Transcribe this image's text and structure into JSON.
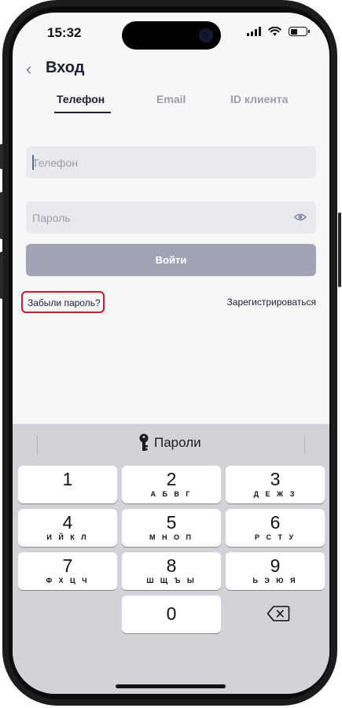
{
  "status_bar": {
    "time": "15:32"
  },
  "header": {
    "title": "Вход"
  },
  "tabs": [
    {
      "label": "Телефон",
      "active": true
    },
    {
      "label": "Email",
      "active": false
    },
    {
      "label": "ID клиента",
      "active": false
    }
  ],
  "form": {
    "phone_placeholder": "Телефон",
    "password_placeholder": "Пароль",
    "login_button": "Войти",
    "forgot_password": "Забыли пароль?",
    "register": "Зарегистрироваться"
  },
  "keyboard": {
    "passwords_label": "Пароли",
    "keys": [
      {
        "digit": "1",
        "letters": ""
      },
      {
        "digit": "2",
        "letters": "А Б В Г"
      },
      {
        "digit": "3",
        "letters": "Д Е Ж З"
      },
      {
        "digit": "4",
        "letters": "И Й К Л"
      },
      {
        "digit": "5",
        "letters": "М Н О П"
      },
      {
        "digit": "6",
        "letters": "Р С Т У"
      },
      {
        "digit": "7",
        "letters": "Ф Х Ц Ч"
      },
      {
        "digit": "8",
        "letters": "Ш Щ Ъ Ы"
      },
      {
        "digit": "9",
        "letters": "Ь Э Ю Я"
      },
      {
        "digit": "0",
        "letters": ""
      }
    ]
  },
  "colors": {
    "accent": "#1d1f36",
    "button_disabled": "#a2a4b6",
    "highlight_border": "#d6162a",
    "field_bg": "#e9e9ee"
  },
  "icons": [
    "back-chevron-icon",
    "eye-icon",
    "key-icon",
    "delete-icon",
    "wifi-icon",
    "signal-icon",
    "battery-icon"
  ]
}
